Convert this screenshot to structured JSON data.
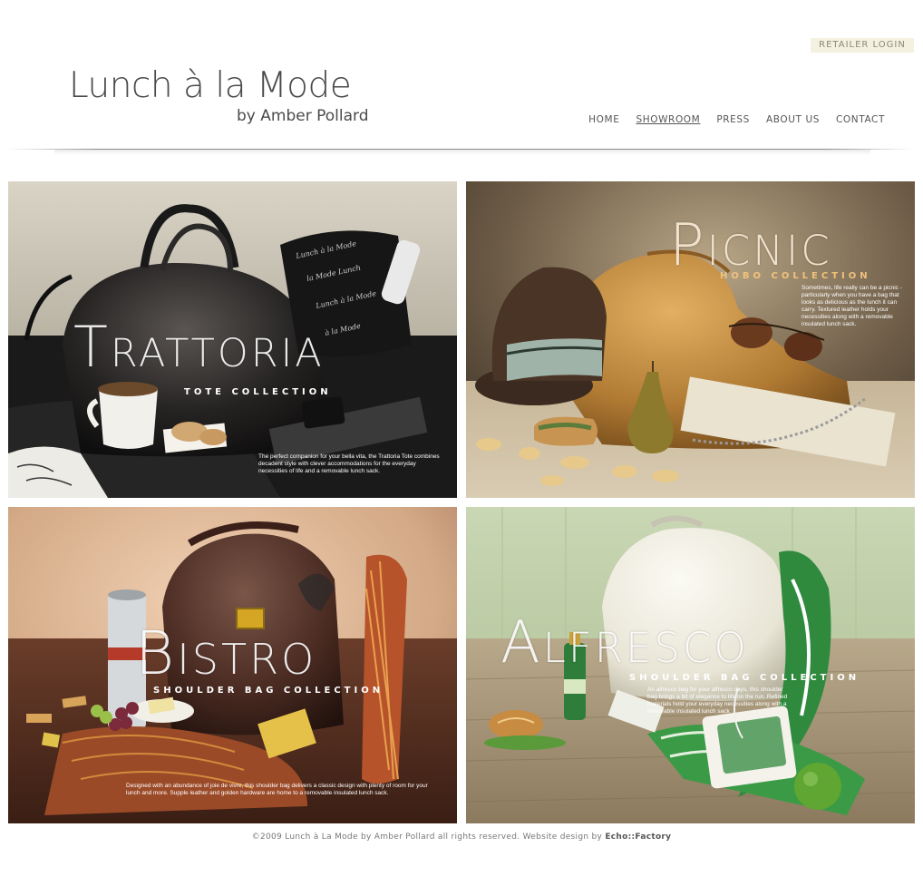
{
  "header": {
    "retailer_login": "RETAILER LOGIN",
    "logo_main": "Lunch à la Mode",
    "logo_sub": "by Amber Pollard"
  },
  "nav": {
    "items": [
      "HOME",
      "SHOWROOM",
      "PRESS",
      "ABOUT US",
      "CONTACT"
    ],
    "active": "SHOWROOM"
  },
  "collections": [
    {
      "title": "Trattoria",
      "subtitle": "TOTE COLLECTION",
      "description": "The perfect companion for your bella vita, the Trattoria Tote combines decadent style with clever accommodations for the everyday necessities of life and a removable lunch sack."
    },
    {
      "title": "Picnic",
      "subtitle": "HOBO COLLECTION",
      "description": "Sometimes, life really can be a picnic - particularly when you have a bag that looks as delicious as the lunch it can carry. Textured leather holds your necessities along with a removable insulated lunch sack."
    },
    {
      "title": "Bistro",
      "subtitle": "SHOULDER BAG COLLECTION",
      "description": "Designed with an abundance of joie de vivre, this shoulder bag delivers a classic design with plenty of room for your lunch and more. Supple leather and golden hardware are home to a removable insulated lunch sack."
    },
    {
      "title": "Alfresco",
      "subtitle": "SHOULDER BAG COLLECTION",
      "description": "An alfresco bag for your alfresco days, this shoulder bag brings a bit of elegance to life on the run. Refined materials hold your everyday necessities along with a removable insulated lunch sack"
    }
  ],
  "footer": {
    "copyright": "©2009 Lunch à La Mode by Amber Pollard all rights reserved. Website design by",
    "credit": "Echo::Factory"
  },
  "colors": {
    "nav_text": "#555555",
    "retailer_bg": "#f4f1e1",
    "picnic_accent": "#f1c27b"
  }
}
